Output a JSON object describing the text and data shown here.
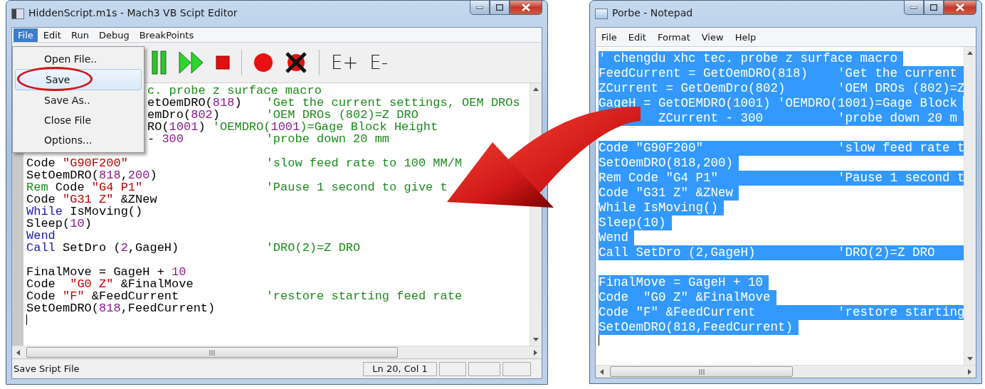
{
  "editor_window": {
    "title": "HiddenScript.m1s - Mach3 VB Scipt Editor",
    "menu": [
      {
        "label": "File",
        "selected": true
      },
      {
        "label": "Edit",
        "selected": false
      },
      {
        "label": "Run",
        "selected": false
      },
      {
        "label": "Debug",
        "selected": false
      },
      {
        "label": "BreakPoints",
        "selected": false
      }
    ],
    "file_menu": [
      {
        "label": "Open File..",
        "selected": false,
        "circled": false
      },
      {
        "label": "Save",
        "selected": true,
        "circled": true
      },
      {
        "label": "Save As..",
        "selected": false,
        "circled": false
      },
      {
        "label": "Close File",
        "selected": false,
        "circled": false
      },
      {
        "label": "Options...",
        "selected": false,
        "circled": false
      }
    ],
    "toolbar": [
      {
        "kind": "pause"
      },
      {
        "kind": "run"
      },
      {
        "kind": "stop"
      },
      {
        "kind": "separator"
      },
      {
        "kind": "breakpoint"
      },
      {
        "kind": "clear-breakpoints"
      },
      {
        "kind": "separator"
      },
      {
        "kind": "text",
        "label": "E+"
      },
      {
        "kind": "text",
        "label": "E-"
      }
    ],
    "code": [
      {
        "kind": "behind-menu",
        "segments": [
          {
            "kind": "comment",
            "text": "c. probe z surface macro"
          }
        ]
      },
      {
        "kind": "behind-menu",
        "segments": [
          {
            "kind": "plain",
            "text": "etOemDRO("
          },
          {
            "kind": "number",
            "text": "818"
          },
          {
            "kind": "plain",
            "text": ")"
          }
        ],
        "comment": "'Get the current settings, OEM DROs"
      },
      {
        "kind": "behind-menu",
        "segments": [
          {
            "kind": "plain",
            "text": "emDro("
          },
          {
            "kind": "number",
            "text": "802"
          },
          {
            "kind": "plain",
            "text": ")"
          }
        ],
        "comment": "'OEM DROs (802)=Z DRO"
      },
      {
        "kind": "behind-menu",
        "segments": [
          {
            "kind": "plain",
            "text": "RO("
          },
          {
            "kind": "number",
            "text": "1001"
          },
          {
            "kind": "plain",
            "text": ") "
          },
          {
            "kind": "comment",
            "text": "'OEMDRO("
          },
          {
            "kind": "number",
            "text": "1001"
          },
          {
            "kind": "comment",
            "text": ")=Gage Block Height"
          }
        ]
      },
      {
        "kind": "behind-menu",
        "segments": [
          {
            "kind": "plain",
            "text": "- "
          },
          {
            "kind": "number",
            "text": "300"
          }
        ],
        "comment": "'probe down 20 mm"
      },
      {
        "kind": "blank"
      },
      {
        "kind": "normal",
        "segments": [
          {
            "kind": "plain",
            "text": "Code "
          },
          {
            "kind": "string",
            "text": "\"G90F200\""
          }
        ],
        "comment": "'slow feed rate to 100 MM/M"
      },
      {
        "kind": "normal",
        "segments": [
          {
            "kind": "plain",
            "text": "SetOemDRO("
          },
          {
            "kind": "number",
            "text": "818"
          },
          {
            "kind": "plain",
            "text": ","
          },
          {
            "kind": "number",
            "text": "200"
          },
          {
            "kind": "plain",
            "text": ")"
          }
        ]
      },
      {
        "kind": "normal",
        "segments": [
          {
            "kind": "comment",
            "text": "Rem"
          },
          {
            "kind": "plain",
            "text": " Code "
          },
          {
            "kind": "string",
            "text": "\"G4 P1\""
          }
        ],
        "comment": "'Pause 1 second to give t"
      },
      {
        "kind": "normal",
        "segments": [
          {
            "kind": "plain",
            "text": "Code "
          },
          {
            "kind": "string",
            "text": "\"G31 Z\""
          },
          {
            "kind": "plain",
            "text": " &ZNew"
          }
        ]
      },
      {
        "kind": "normal",
        "segments": [
          {
            "kind": "keyword",
            "text": "While"
          },
          {
            "kind": "plain",
            "text": " IsMoving()"
          }
        ]
      },
      {
        "kind": "normal",
        "segments": [
          {
            "kind": "plain",
            "text": "Sleep("
          },
          {
            "kind": "number",
            "text": "10"
          },
          {
            "kind": "plain",
            "text": ")"
          }
        ]
      },
      {
        "kind": "normal",
        "segments": [
          {
            "kind": "keyword",
            "text": "Wend"
          }
        ]
      },
      {
        "kind": "normal",
        "segments": [
          {
            "kind": "keyword",
            "text": "Call"
          },
          {
            "kind": "plain",
            "text": " SetDro ("
          },
          {
            "kind": "number",
            "text": "2"
          },
          {
            "kind": "plain",
            "text": ",GageH)"
          }
        ],
        "comment": "'DRO(2)=Z DRO"
      },
      {
        "kind": "blank"
      },
      {
        "kind": "normal",
        "segments": [
          {
            "kind": "plain",
            "text": "FinalMove = GageH + "
          },
          {
            "kind": "number",
            "text": "10"
          }
        ]
      },
      {
        "kind": "normal",
        "segments": [
          {
            "kind": "plain",
            "text": "Code  "
          },
          {
            "kind": "string",
            "text": "\"G0 Z\""
          },
          {
            "kind": "plain",
            "text": " &FinalMove"
          }
        ]
      },
      {
        "kind": "normal",
        "segments": [
          {
            "kind": "plain",
            "text": "Code "
          },
          {
            "kind": "string",
            "text": "\"F\""
          },
          {
            "kind": "plain",
            "text": " &FeedCurrent"
          }
        ],
        "comment": "'restore starting feed rate"
      },
      {
        "kind": "normal",
        "segments": [
          {
            "kind": "plain",
            "text": "SetOemDRO("
          },
          {
            "kind": "number",
            "text": "818"
          },
          {
            "kind": "plain",
            "text": ",FeedCurrent)"
          }
        ]
      }
    ],
    "status": {
      "message": "Save Sript File",
      "position": "Ln 20, Col 1"
    }
  },
  "notepad_window": {
    "title": "Porbe - Notepad",
    "menu": [
      "File",
      "Edit",
      "Format",
      "View",
      "Help"
    ],
    "lines": [
      {
        "kind": "normal",
        "text": "' chengdu xhc tec. probe z surface macro",
        "selected": true
      },
      {
        "kind": "normal",
        "text": "FeedCurrent = GetOemDRO(818)",
        "comment": "'Get the current",
        "selected": true
      },
      {
        "kind": "normal",
        "text": "ZCurrent = GetOemDro(802)",
        "comment": "'OEM DROs (802)=Z",
        "selected": true
      },
      {
        "kind": "normal",
        "text": "GageH = GetOEMDRO(1001) 'OEMDRO(1001)=Gage Block",
        "selected": true
      },
      {
        "kind": "behind-arrow",
        "text": "ZCurrent - 300",
        "comment": "'probe down 20 m",
        "selected": true
      },
      {
        "kind": "blank"
      },
      {
        "kind": "normal",
        "text": "Code \"G90F200\"",
        "comment": "'slow feed rate t",
        "selected": true
      },
      {
        "kind": "normal",
        "text": "SetOemDRO(818,200)",
        "selected": true
      },
      {
        "kind": "normal",
        "text": "Rem Code \"G4 P1\"",
        "comment": "'Pause 1 second t",
        "selected": true
      },
      {
        "kind": "normal",
        "text": "Code \"G31 Z\" &ZNew",
        "selected": true
      },
      {
        "kind": "normal",
        "text": "While IsMoving()",
        "selected": true
      },
      {
        "kind": "normal",
        "text": "Sleep(10)",
        "selected": true
      },
      {
        "kind": "normal",
        "text": "Wend",
        "selected": true
      },
      {
        "kind": "normal",
        "text": "Call SetDro (2,GageH)",
        "comment": "'DRO(2)=Z DRO",
        "selected": true
      },
      {
        "kind": "blank"
      },
      {
        "kind": "normal",
        "text": "FinalMove = GageH + 10",
        "selected": true
      },
      {
        "kind": "normal",
        "text": "Code  \"G0 Z\" &FinalMove",
        "selected": true
      },
      {
        "kind": "normal",
        "text": "Code \"F\" &FeedCurrent",
        "comment": "'restore starting",
        "selected": true
      },
      {
        "kind": "normal",
        "text": "SetOemDRO(818,FeedCurrent)",
        "selected": true
      }
    ]
  }
}
